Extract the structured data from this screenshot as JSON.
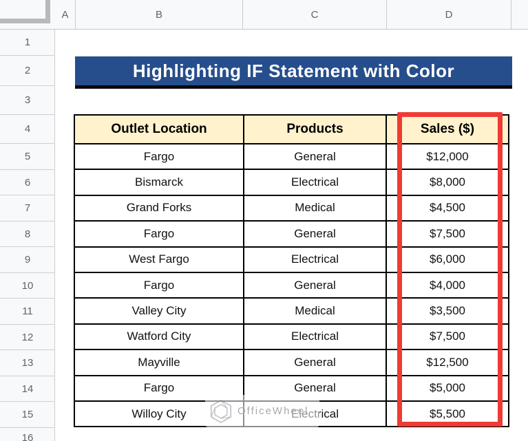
{
  "colors": {
    "banner_bg": "#264E8C",
    "banner_text": "#FFFFFF",
    "table_header_bg": "#FFF2CC",
    "table_border": "#000000",
    "highlight_border": "#EF3B33",
    "header_strip_bg": "#F8F9FA",
    "header_strip_text": "#5F6368"
  },
  "column_headers": [
    "A",
    "B",
    "C",
    "D"
  ],
  "row_headers": [
    "1",
    "2",
    "3",
    "4",
    "5",
    "6",
    "7",
    "8",
    "9",
    "10",
    "11",
    "12",
    "13",
    "14",
    "15",
    "16"
  ],
  "banner": {
    "title": "Highlighting IF Statement with Color"
  },
  "table": {
    "columns": [
      "Outlet Location",
      "Products",
      "Sales ($)"
    ],
    "rows": [
      [
        "Fargo",
        "General",
        "$12,000"
      ],
      [
        "Bismarck",
        "Electrical",
        "$8,000"
      ],
      [
        "Grand Forks",
        "Medical",
        "$4,500"
      ],
      [
        "Fargo",
        "General",
        "$7,500"
      ],
      [
        "West Fargo",
        "Electrical",
        "$6,000"
      ],
      [
        "Fargo",
        "General",
        "$4,000"
      ],
      [
        "Valley City",
        "Medical",
        "$3,500"
      ],
      [
        "Watford City",
        "Electrical",
        "$7,500"
      ],
      [
        "Mayville",
        "General",
        "$12,500"
      ],
      [
        "Fargo",
        "General",
        "$5,000"
      ],
      [
        "Willoy City",
        "Electrical",
        "$5,500"
      ]
    ]
  },
  "watermark": {
    "text": "OfficeWheel",
    "icon": "hexagon-logo"
  }
}
